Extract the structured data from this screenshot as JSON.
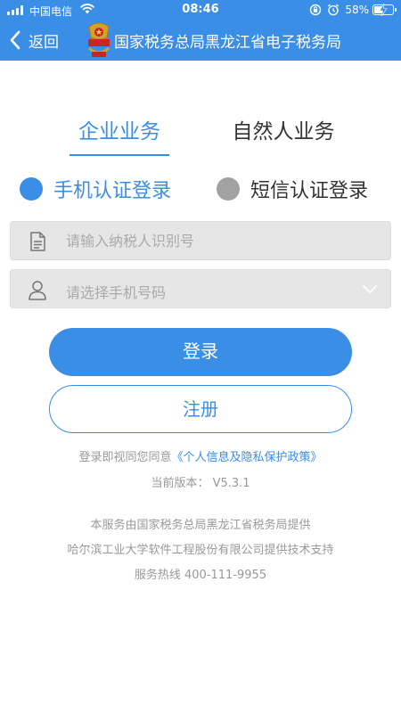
{
  "status_bar": {
    "carrier": "中国电信",
    "time": "08:46",
    "battery_percent": "58%",
    "battery_level": 0.58,
    "icons": [
      "signal-icon",
      "wifi-icon",
      "orientation-lock-icon",
      "alarm-icon",
      "battery-icon"
    ]
  },
  "nav": {
    "back_label": "返回",
    "title": "国家税务总局黑龙江省电子税务局",
    "icons": [
      "back-chevron-icon",
      "tax-emblem-icon"
    ]
  },
  "tabs": [
    {
      "label": "企业业务",
      "active": true
    },
    {
      "label": "自然人业务",
      "active": false
    }
  ],
  "login_modes": [
    {
      "label": "手机认证登录",
      "selected": true
    },
    {
      "label": "短信认证登录",
      "selected": false
    }
  ],
  "form": {
    "taxid_placeholder": "请输入纳税人识别号",
    "phone_placeholder": "请选择手机号码",
    "icons": [
      "document-icon",
      "user-icon",
      "chevron-down-icon"
    ]
  },
  "buttons": {
    "login": "登录",
    "register": "注册"
  },
  "agreement": {
    "prefix": "登录即视同您同意",
    "link": "《个人信息及隐私保护政策》"
  },
  "version_text": "当前版本： V5.3.1",
  "footer": [
    "本服务由国家税务总局黑龙江省税务局提供",
    "哈尔滨工业大学软件工程股份有限公司提供技术支持",
    "服务热线 400-111-9955"
  ],
  "colors": {
    "primary": "#3a8ee6",
    "inactive_radio": "#a2a2a2",
    "field_bg": "#e6e6e6",
    "muted_text": "#999999"
  }
}
